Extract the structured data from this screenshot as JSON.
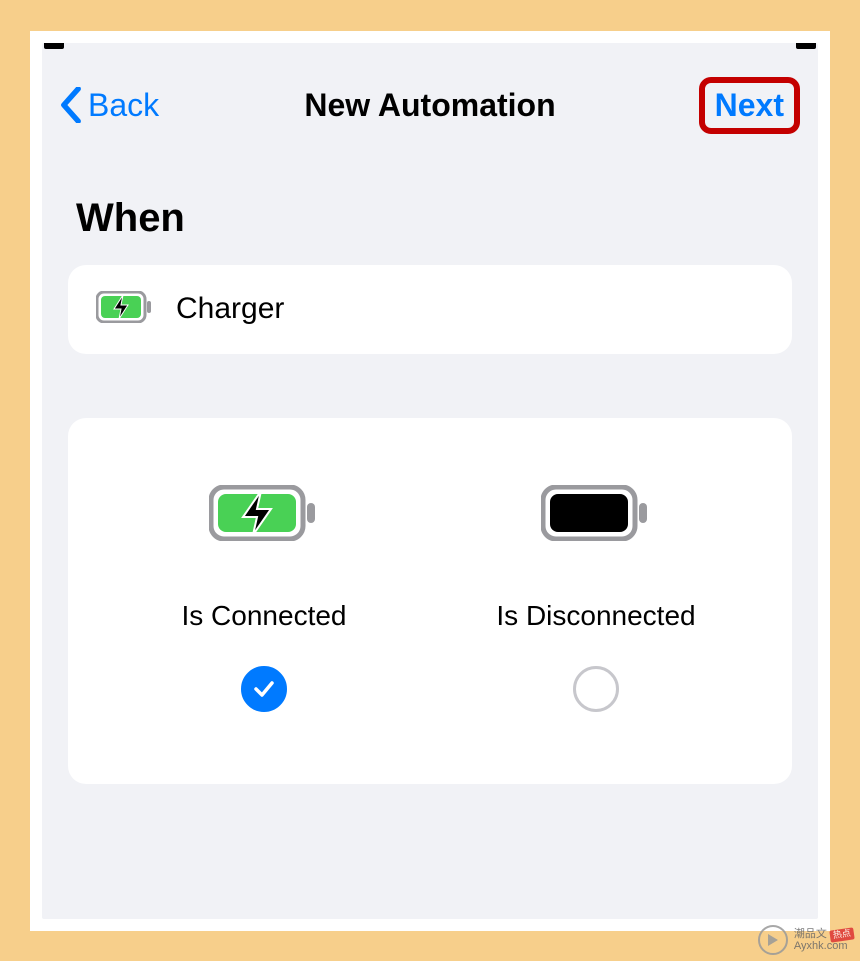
{
  "nav": {
    "back_label": "Back",
    "title": "New Automation",
    "next_label": "Next"
  },
  "section": {
    "heading": "When"
  },
  "trigger": {
    "name": "Charger"
  },
  "options": {
    "connected": {
      "label": "Is Connected",
      "selected": true
    },
    "disconnected": {
      "label": "Is Disconnected",
      "selected": false
    }
  },
  "watermark": {
    "line1": "潮品文",
    "line2": "Ayxhk.com"
  }
}
